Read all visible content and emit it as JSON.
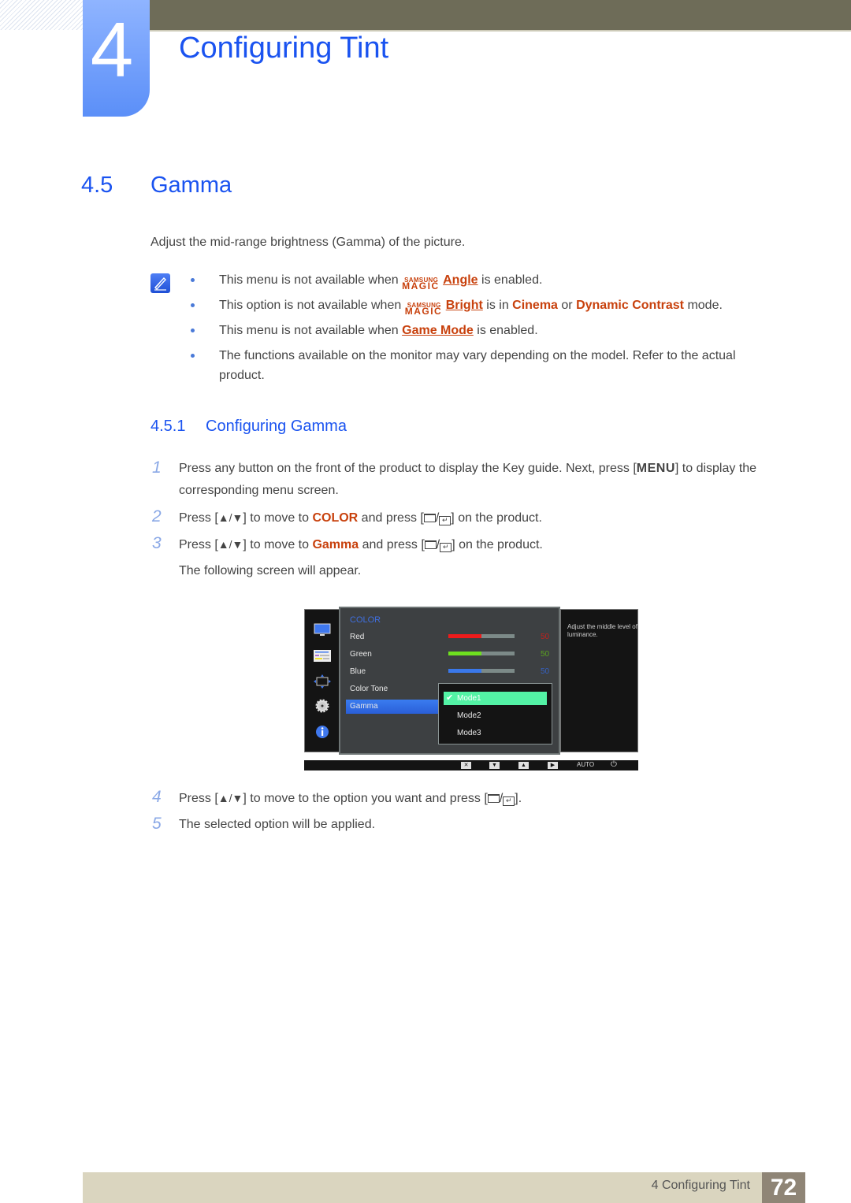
{
  "header": {
    "chapter_number": "4",
    "chapter_title": "Configuring Tint"
  },
  "section": {
    "number": "4.5",
    "title": "Gamma",
    "intro": "Adjust the mid-range brightness (Gamma) of the picture."
  },
  "notes": {
    "icon": "note-pencil-icon",
    "magic_brand_top": "SAMSUNG",
    "magic_brand_bottom": "MAGIC",
    "items": [
      {
        "pre": "This menu is not available when ",
        "link": "Angle",
        "post": " is enabled."
      },
      {
        "pre": "This option is not available when ",
        "link": "Bright",
        "mid1": " is in ",
        "hl1": "Cinema",
        "mid2": " or ",
        "hl2": "Dynamic Contrast",
        "post": " mode."
      },
      {
        "pre": "This menu is not available when ",
        "link": "Game Mode",
        "post": " is enabled."
      },
      {
        "text": "The functions available on the monitor may vary depending on the model. Refer to the actual product."
      }
    ]
  },
  "subsection": {
    "number": "4.5.1",
    "title": "Configuring Gamma"
  },
  "steps": [
    {
      "n": "1",
      "pre": "Press any button on the front of the product to display the Key guide. Next, press [",
      "key": "MENU",
      "post": "] to display the corresponding menu screen."
    },
    {
      "n": "2",
      "pre": "Press [",
      "arrows": "▲/▼",
      "mid": "] to move to ",
      "hl": "COLOR",
      "mid2": " and press [",
      "post": "] on the product."
    },
    {
      "n": "3",
      "pre": "Press [",
      "arrows": "▲/▼",
      "mid": "] to move to ",
      "hl": "Gamma",
      "mid2": " and press [",
      "post": "] on the product.",
      "extra": "The following screen will appear."
    },
    {
      "n": "4",
      "pre": "Press [",
      "arrows": "▲/▼",
      "mid": "] to move to the option you want and press [",
      "post": "]."
    },
    {
      "n": "5",
      "text": "The selected option will be applied."
    }
  ],
  "osd": {
    "category": "COLOR",
    "sidebar_icons": [
      "monitor-icon",
      "picture-settings-icon",
      "position-arrows-icon",
      "gear-icon",
      "info-icon"
    ],
    "items": [
      {
        "label": "Red",
        "value": "50",
        "fraction": 0.5,
        "color": "#ee1b1b",
        "value_color": "#c0201c"
      },
      {
        "label": "Green",
        "value": "50",
        "fraction": 0.5,
        "color": "#6ee01f",
        "value_color": "#5aa020"
      },
      {
        "label": "Blue",
        "value": "50",
        "fraction": 0.5,
        "color": "#3a78ea",
        "value_color": "#3560c0"
      },
      {
        "label": "Color Tone"
      },
      {
        "label": "Gamma",
        "selected": true
      }
    ],
    "submenu": [
      {
        "label": "Mode1",
        "selected": true
      },
      {
        "label": "Mode2"
      },
      {
        "label": "Mode3"
      }
    ],
    "help_text": "Adjust the middle level of luminance.",
    "footer_keys": [
      "✕",
      "▼",
      "▲",
      "▶"
    ],
    "footer_auto": "AUTO",
    "footer_power": "⏻"
  },
  "footer": {
    "chapter_label": "4 Configuring Tint",
    "page_number": "72"
  }
}
